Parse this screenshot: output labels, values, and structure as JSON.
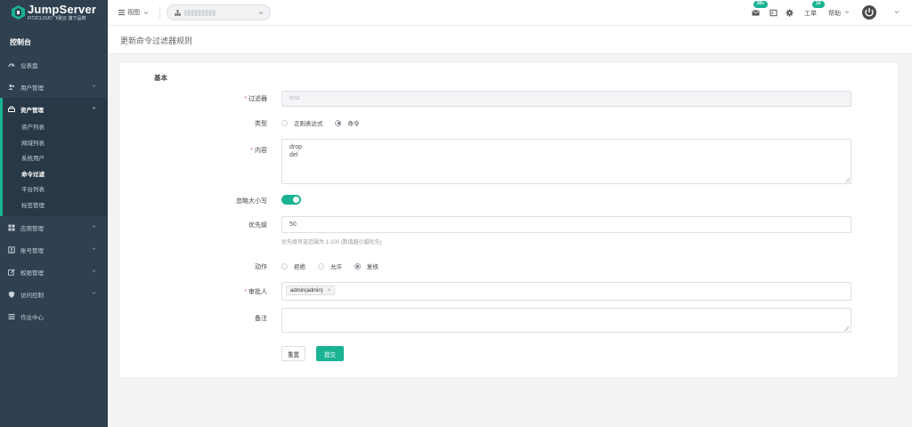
{
  "brand": {
    "name": "JumpServer",
    "subtitle": "FIT2CLOUD 飞致云  旗下品牌"
  },
  "sidebar": {
    "console_label": "控制台",
    "items": [
      {
        "label": "仪表盘",
        "icon": "dashboard-icon"
      },
      {
        "label": "用户管理",
        "icon": "users-icon"
      },
      {
        "label": "资产管理",
        "icon": "hdd-icon",
        "expanded": true,
        "children": [
          "资产列表",
          "网域列表",
          "系统用户",
          "命令过滤",
          "平台列表",
          "标签管理"
        ],
        "current": "命令过滤"
      },
      {
        "label": "应用管理",
        "icon": "apps-icon"
      },
      {
        "label": "账号管理",
        "icon": "account-icon"
      },
      {
        "label": "权限管理",
        "icon": "edit-icon"
      },
      {
        "label": "访问控制",
        "icon": "shield-icon"
      },
      {
        "label": "作业中心",
        "icon": "list-icon"
      }
    ]
  },
  "topbar": {
    "view_label": "视图",
    "mail_badge": "99+",
    "ticket_label": "工单",
    "ticket_badge": "10",
    "help_label": "帮助"
  },
  "page": {
    "title": "更新命令过滤器规则"
  },
  "form": {
    "section": "基本",
    "filter": {
      "label": "过滤器",
      "value": "test"
    },
    "type": {
      "label": "类型",
      "options": [
        "正则表达式",
        "命令"
      ],
      "selected": "命令"
    },
    "content": {
      "label": "内容",
      "lines": [
        "drop",
        "del"
      ]
    },
    "ignore_case": {
      "label": "忽略大小写",
      "on": true
    },
    "priority": {
      "label": "优先级",
      "value": "50",
      "help": "优先级可选范围为 1-100 (数值越小越优先)"
    },
    "action": {
      "label": "动作",
      "options": [
        "拒绝",
        "允许",
        "复核"
      ],
      "selected": "复核"
    },
    "reviewers": {
      "label": "审批人",
      "tags": [
        "admin(admin)"
      ]
    },
    "comment": {
      "label": "备注",
      "value": ""
    },
    "reset_label": "重置",
    "submit_label": "提交"
  },
  "colors": {
    "accent": "#1ab394",
    "sidebar_bg": "#2f4050",
    "required": "#ed5565"
  }
}
